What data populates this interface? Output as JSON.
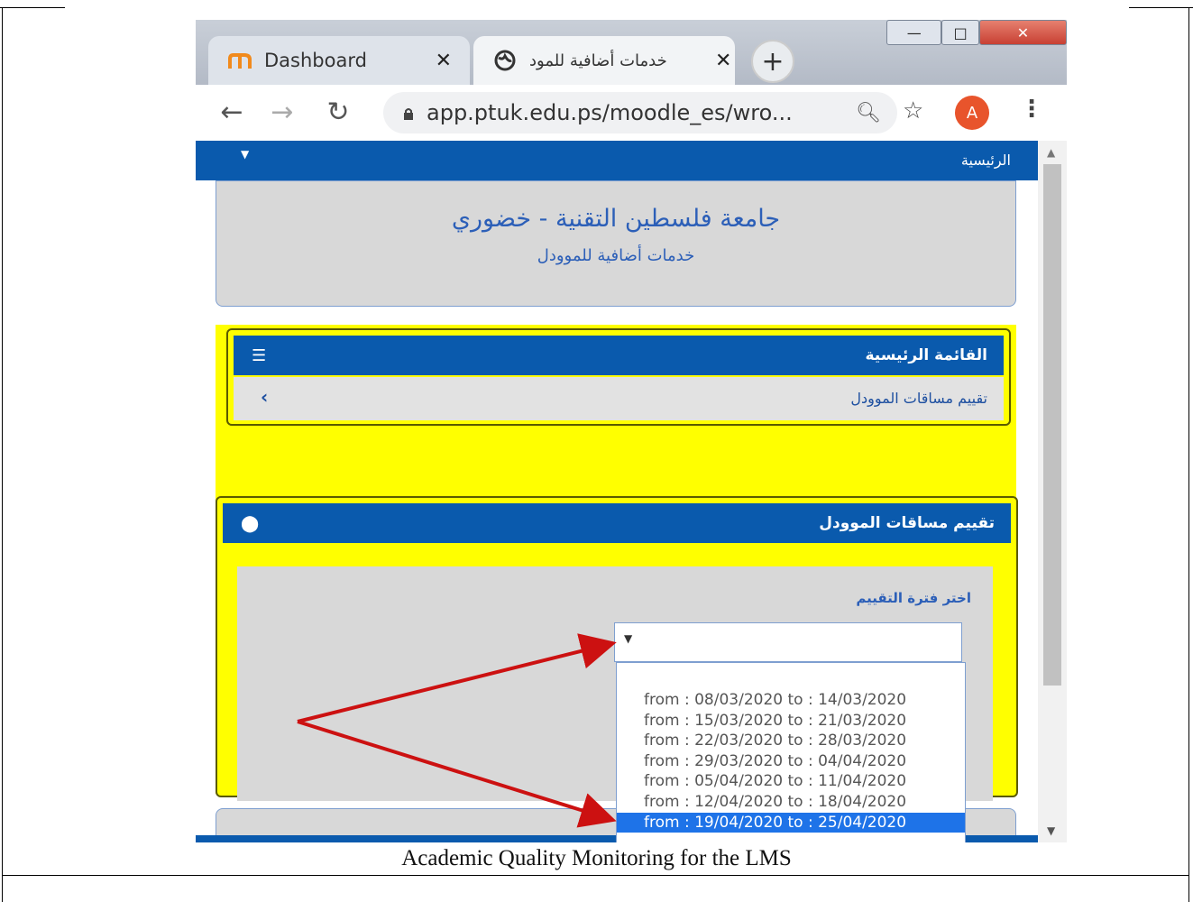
{
  "caption": "Academic Quality Monitoring for the LMS",
  "browser": {
    "tabs": [
      {
        "title": "Dashboard",
        "icon": "moodle-icon",
        "active": false
      },
      {
        "title": "خدمات أضافية للمود",
        "icon": "globe-icon",
        "active": true
      }
    ],
    "new_tab": "+",
    "window_controls": {
      "minimize": "—",
      "maximize": "□",
      "close": "✕"
    },
    "url": "app.ptuk.edu.ps/moodle_es/wro...",
    "avatar_letter": "A"
  },
  "page": {
    "nav_home": "الرئيسية",
    "university_name": "جامعة فلسطين التقنية - خضوري",
    "subtitle": "خدمات أضافية للموودل",
    "main_menu": {
      "title": "القائمة الرئيسية",
      "item": "تقييم مساقات الموودل"
    },
    "eval_block": {
      "title": "تقييم مساقات الموودل",
      "period_label": "اختر فترة التقييم",
      "options": [
        "from : 08/03/2020 to : 14/03/2020",
        "from : 15/03/2020 to : 21/03/2020",
        "from : 22/03/2020 to : 28/03/2020",
        "from : 29/03/2020 to : 04/04/2020",
        "from : 05/04/2020 to : 11/04/2020",
        "from : 12/04/2020 to : 18/04/2020",
        "from : 19/04/2020 to : 25/04/2020"
      ],
      "selected_index": 6
    }
  },
  "colors": {
    "nav_blue": "#0a5aad",
    "highlight_yellow": "#ffff00",
    "selected_option": "#1e73e8",
    "arrow_red": "#cc1111"
  }
}
